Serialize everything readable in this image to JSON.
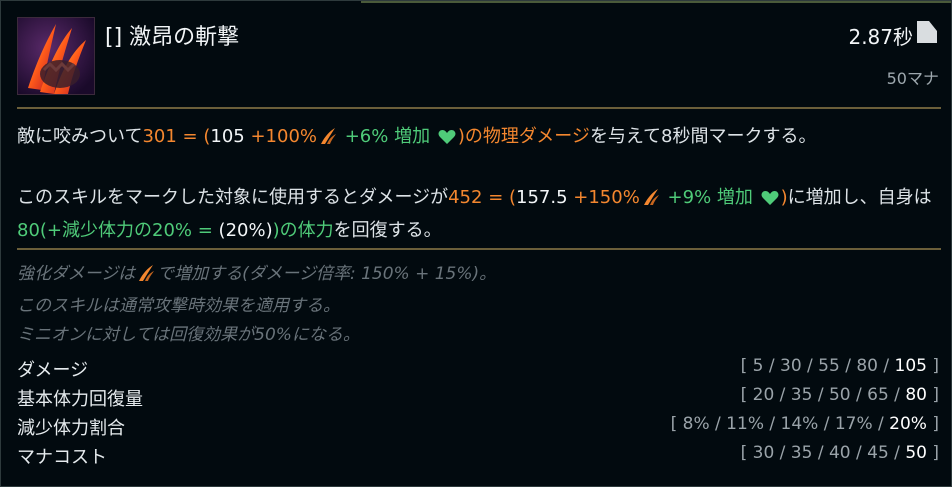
{
  "ability": {
    "title": "[] 激昂の斬撃",
    "cooldown": "2.87秒",
    "cost": "50マナ"
  },
  "icons": {
    "ability_icon": "claw-slash-icon",
    "cooldown_icon": "cooldown-flag-icon",
    "attack_damage_icon": "attack-damage-claw-icon",
    "health_icon": "heart-icon"
  },
  "colors": {
    "physical": "#f4872f",
    "bonus": "#4fcb79",
    "divider": "#6b5f3a"
  },
  "desc1": {
    "intro": "敵に咬みついて",
    "dmg_total": "301 = (",
    "dmg_base": "105",
    "dmg_ratio": " +100%",
    "dmg_bonus": " +6% 増加 ",
    "dmg_close": ")の物理ダメージ",
    "outro": "を与えて8秒間マークする。"
  },
  "desc2": {
    "intro": "このスキルをマークした対象に使用するとダメージが",
    "dmg_total": "452 = (",
    "dmg_base": "157.5",
    "dmg_ratio": " +150%",
    "dmg_bonus": " +9% 増加 ",
    "dmg_close": ")",
    "mid": "に増加し、自身は",
    "heal_a": "80(+減少体力の20% = ",
    "heal_b": "(20%)",
    "heal_c": ")の体力",
    "outro": "を回復する。"
  },
  "notes": [
    {
      "before": "強化ダメージは",
      "after": "で増加する(ダメージ倍率: 150% + 15%)。"
    },
    {
      "text": "このスキルは通常攻撃時効果を適用する。"
    },
    {
      "text": "ミニオンに対しては回復効果が50%になる。"
    }
  ],
  "stats": [
    {
      "label": "ダメージ",
      "values": "[ 5 / 30 / 55 / 80 / ",
      "last": "105",
      "close": " ]"
    },
    {
      "label": "基本体力回復量",
      "values": "[ 20 / 35 / 50 / 65 / ",
      "last": "80",
      "close": " ]"
    },
    {
      "label": "減少体力割合",
      "values": "[ 8% / 11% / 14% / 17% / ",
      "last": "20%",
      "close": " ]"
    },
    {
      "label": "マナコスト",
      "values": "[ 30 / 35 / 40 / 45 / ",
      "last": "50",
      "close": " ]"
    }
  ]
}
